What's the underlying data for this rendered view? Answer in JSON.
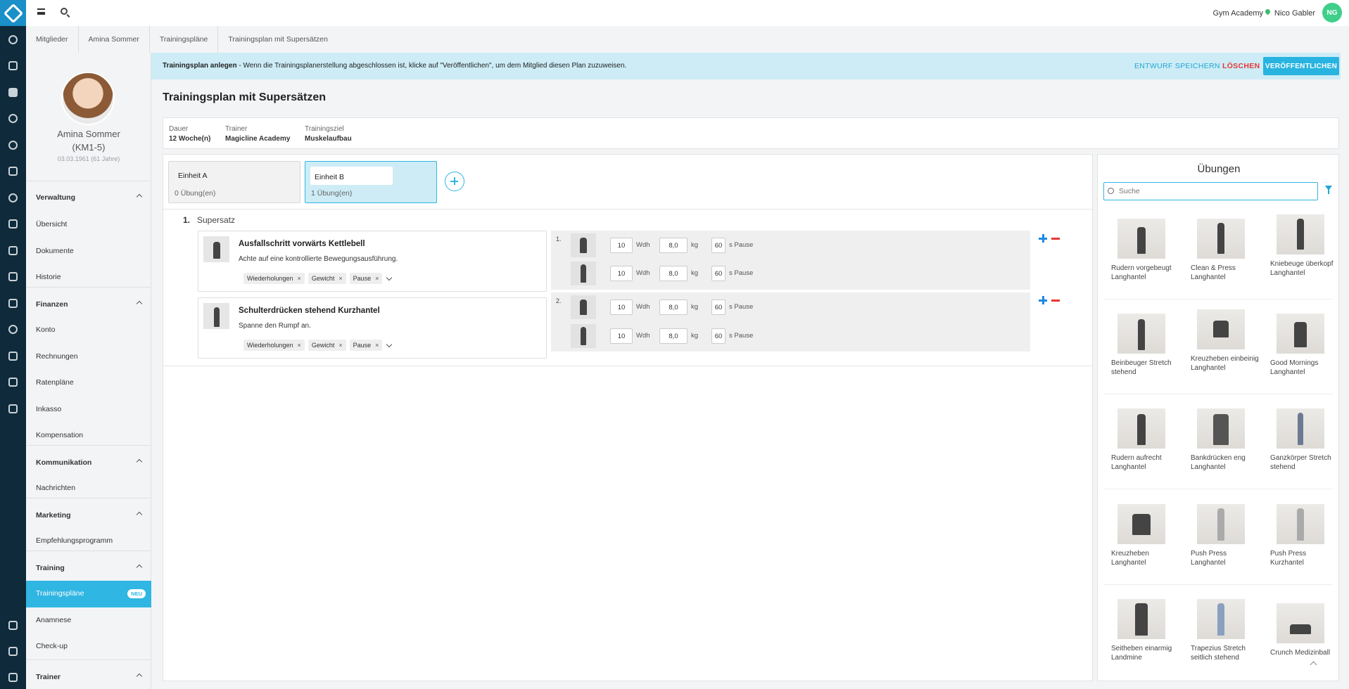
{
  "topbar": {
    "studio": "Gym Academy",
    "user_name": "Nico Gabler",
    "user_initials": "NG"
  },
  "breadcrumb": [
    "Mitglieder",
    "Amina Sommer",
    "Trainingspläne",
    "Trainingsplan mit Supersätzen"
  ],
  "member": {
    "name": "Amina Sommer",
    "id": "(KM1-5)",
    "birth": "03.03.1961 (61 Jahre)"
  },
  "sidebar": {
    "sections": [
      {
        "title": "Verwaltung",
        "items": [
          "Übersicht",
          "Dokumente",
          "Historie"
        ]
      },
      {
        "title": "Finanzen",
        "items": [
          "Konto",
          "Rechnungen",
          "Ratenpläne",
          "Inkasso",
          "Kompensation"
        ]
      },
      {
        "title": "Kommunikation",
        "items": [
          "Nachrichten"
        ]
      },
      {
        "title": "Marketing",
        "items": [
          "Empfehlungsprogramm"
        ]
      },
      {
        "title": "Training",
        "items": [
          "Trainingspläne",
          "Anamnese",
          "Check-up"
        ]
      },
      {
        "title": "Trainer",
        "items": []
      }
    ],
    "active_item": "Trainingspläne",
    "active_badge": "NEU"
  },
  "banner": {
    "title": "Trainingsplan anlegen",
    "text": " -  Wenn die Trainingsplanerstellung abgeschlossen ist, klicke auf \"Veröffentlichen\", um dem Mitglied diesen Plan zuzuweisen.",
    "draft_label": "ENTWURF SPEICHERN",
    "delete_label": "LÖSCHEN",
    "publish_label": "VERÖFFENTLICHEN"
  },
  "plan": {
    "title": "Trainingsplan mit Supersätzen",
    "meta": [
      {
        "label": "Dauer",
        "value": "12 Woche(n)"
      },
      {
        "label": "Trainer",
        "value": "Magicline Academy"
      },
      {
        "label": "Trainingsziel",
        "value": "Muskelaufbau"
      }
    ],
    "units": [
      {
        "name": "Einheit A",
        "count": "0 Übung(en)"
      },
      {
        "name": "Einheit B",
        "count": "1 Übung(en)"
      }
    ],
    "superset": {
      "number": "1.",
      "label": "Supersatz"
    },
    "exercises": [
      {
        "title": "Ausfallschritt vorwärts Kettlebell",
        "desc": "Achte auf eine kontrollierte Bewegungsausführung.",
        "chips": [
          "Wiederholungen",
          "Gewicht",
          "Pause"
        ]
      },
      {
        "title": "Schulterdrücken stehend Kurzhantel",
        "desc": "Spanne den Rumpf an.",
        "chips": [
          "Wiederholungen",
          "Gewicht",
          "Pause"
        ]
      }
    ],
    "sets": [
      {
        "index": "1.",
        "rows": [
          {
            "reps": "10",
            "weight": "8,0",
            "pause": "60"
          },
          {
            "reps": "10",
            "weight": "8,0",
            "pause": "60"
          }
        ]
      },
      {
        "index": "2.",
        "rows": [
          {
            "reps": "10",
            "weight": "8,0",
            "pause": "60"
          },
          {
            "reps": "10",
            "weight": "8,0",
            "pause": "60"
          }
        ]
      }
    ],
    "units_labels": {
      "reps": "Wdh",
      "weight": "kg",
      "pause": "s Pause"
    }
  },
  "library": {
    "title": "Übungen",
    "search_placeholder": "Suche",
    "exercises": [
      "Rudern vorgebeugt Langhantel",
      "Clean & Press Langhantel",
      "Kniebeuge überkopf Langhantel",
      "Beinbeuger Stretch stehend",
      "Kreuzheben einbeinig Langhantel",
      "Good Mornings Langhantel",
      "Rudern aufrecht Langhantel",
      "Bankdrücken eng Langhantel",
      "Ganzkörper Stretch stehend",
      "Kreuzheben Langhantel",
      "Push Press Langhantel",
      "Push Press Kurzhantel",
      "Seitheben einarmig Landmine",
      "Trapezius Stretch seitlich stehend",
      "Crunch Medizinball"
    ]
  },
  "colors": {
    "accent": "#30b6e2",
    "danger": "#e53935",
    "rail": "#0f2a3b",
    "banner": "#cdecf6"
  }
}
